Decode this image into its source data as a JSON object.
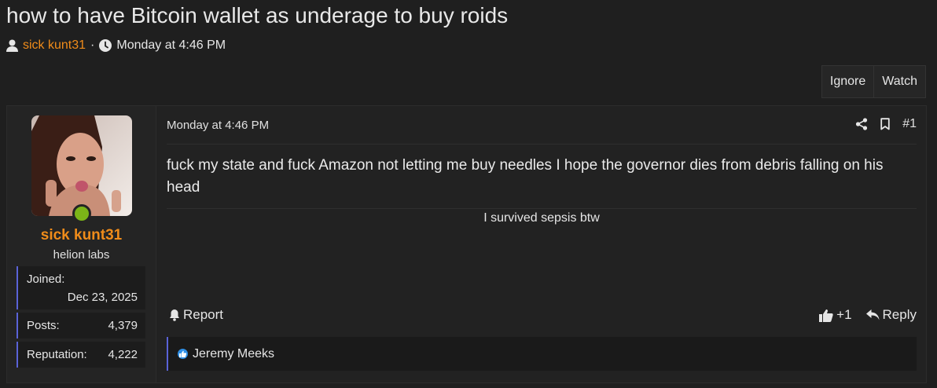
{
  "thread": {
    "title": "how to have Bitcoin wallet as underage to buy roids",
    "author": "sick kunt31",
    "separator": "·",
    "date": "Monday at 4:46 PM"
  },
  "actions": {
    "ignore": "Ignore",
    "watch": "Watch"
  },
  "user": {
    "name": "sick kunt31",
    "title": "helion labs",
    "online_color": "#7cb518",
    "name_color": "#f08c1a",
    "joined_label": "Joined:",
    "joined_value": "Dec 23, 2025",
    "posts_label": "Posts:",
    "posts_value": "4,379",
    "reputation_label": "Reputation:",
    "reputation_value": "4,222"
  },
  "post": {
    "date": "Monday at 4:46 PM",
    "number": "#1",
    "body": "fuck my state and fuck Amazon not letting me buy needles I hope the governor dies from debris falling on his head",
    "signature": "I survived sepsis btw",
    "report": "Report",
    "like_count": "+1",
    "reply": "Reply",
    "reaction_user": "Jeremy Meeks"
  },
  "icons": [
    "user-icon",
    "clock-icon",
    "share-icon",
    "bookmark-icon",
    "bell-icon",
    "thumbs-up-icon",
    "reply-icon",
    "like-badge-icon"
  ]
}
